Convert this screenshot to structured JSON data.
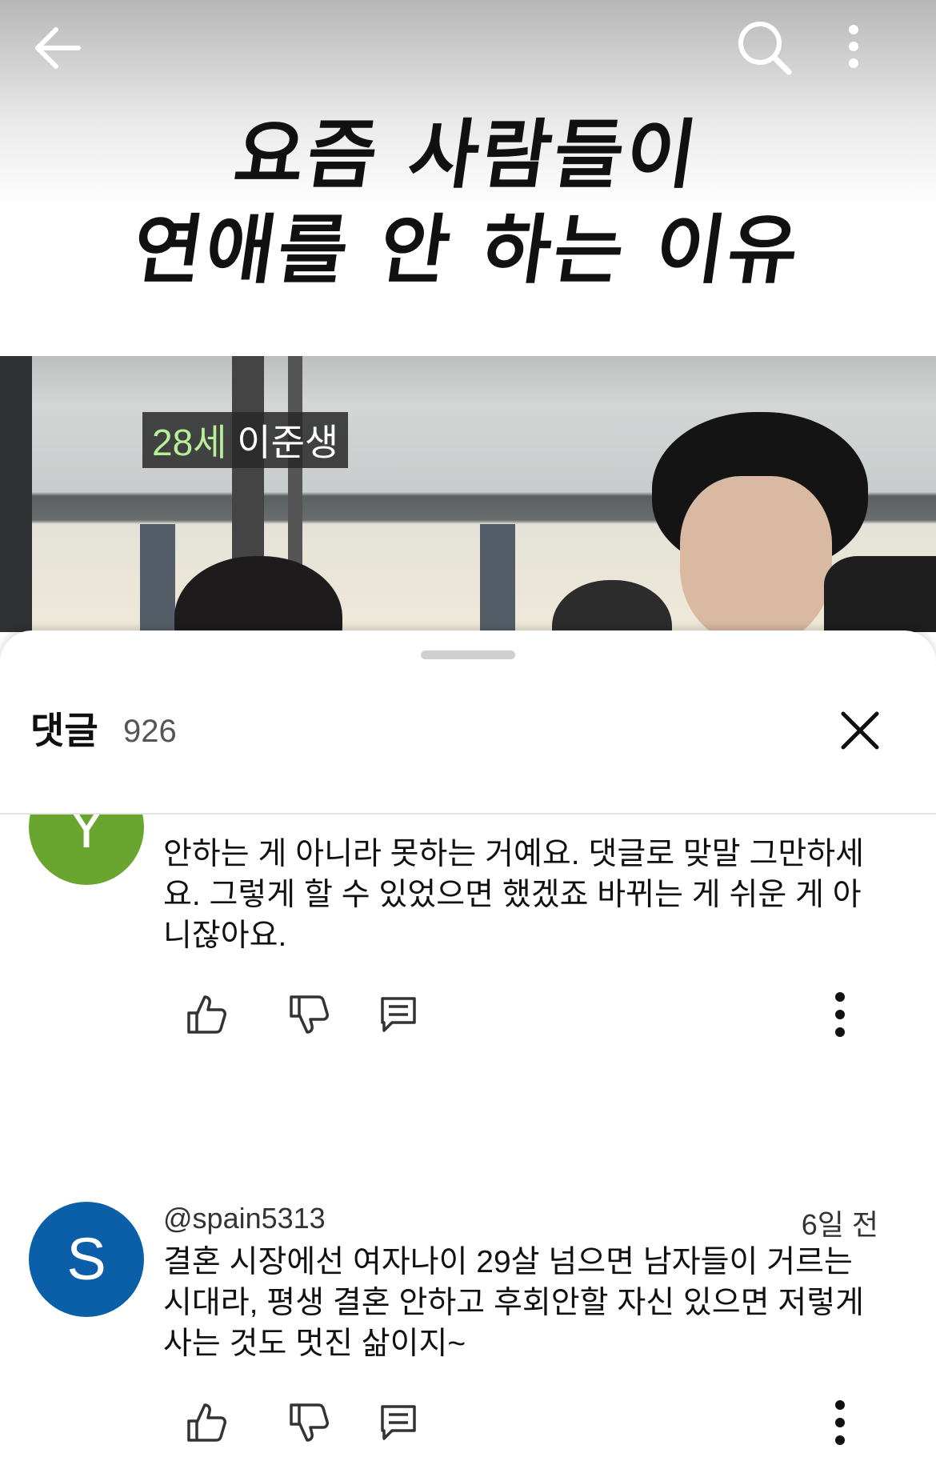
{
  "video": {
    "title_line1": "요즘 사람들이",
    "title_line2": "연애를 안 하는 이유",
    "speaker_age": "28세",
    "speaker_name": "이준생"
  },
  "comments_panel": {
    "title": "댓글",
    "count": "926"
  },
  "comments": [
    {
      "avatar_letter": "Y",
      "avatar_color": "#6aa530",
      "author": "",
      "time": "",
      "text": "안하는 게 아니라 못하는 거예요. 댓글로 맞말 그만하세요. 그렇게 할 수 있었으면 했겠죠 바뀌는 게 쉬운 게 아니잖아요."
    },
    {
      "avatar_letter": "S",
      "avatar_color": "#0b5ea8",
      "author": "@spain5313",
      "time": "6일 전",
      "text": "결혼 시장에선 여자나이 29살 넘으면 남자들이 거르는 시대라, 평생 결혼 안하고 후회안할 자신 있으면 저렇게 사는 것도 멋진 삶이지~"
    }
  ],
  "icons": {
    "back": "arrow-left-icon",
    "search": "search-icon",
    "more": "more-vertical-icon",
    "close": "close-icon",
    "like": "thumbs-up-icon",
    "dislike": "thumbs-down-icon",
    "reply": "comment-icon"
  }
}
